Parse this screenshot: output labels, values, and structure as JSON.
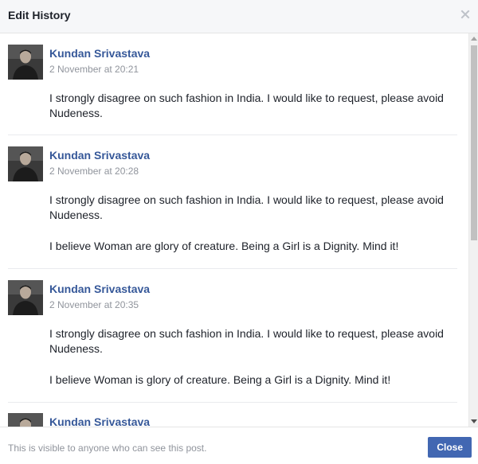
{
  "dialog": {
    "title": "Edit History",
    "close_icon": "close-x-icon"
  },
  "entries": [
    {
      "author": "Kundan Srivastava",
      "timestamp": "2 November at 20:21",
      "paragraphs": [
        "I strongly disagree on such fashion in India. I would like to request, please avoid Nudeness."
      ]
    },
    {
      "author": "Kundan Srivastava",
      "timestamp": "2 November at 20:28",
      "paragraphs": [
        "I strongly disagree on such fashion in India. I would like to request, please avoid Nudeness.",
        "I believe Woman are glory of creature. Being a Girl is a Dignity. Mind it!"
      ]
    },
    {
      "author": "Kundan Srivastava",
      "timestamp": "2 November at 20:35",
      "paragraphs": [
        "I strongly disagree on such fashion in India. I would like to request, please avoid Nudeness.",
        "I believe Woman is glory of creature. Being a Girl is a Dignity. Mind it!"
      ]
    },
    {
      "author": "Kundan Srivastava",
      "timestamp": "",
      "paragraphs": []
    }
  ],
  "footer": {
    "note": "This is visible to anyone who can see this post.",
    "close_label": "Close"
  },
  "colors": {
    "author_link": "#365899",
    "button_bg": "#4267b2",
    "muted_text": "#90949c"
  }
}
